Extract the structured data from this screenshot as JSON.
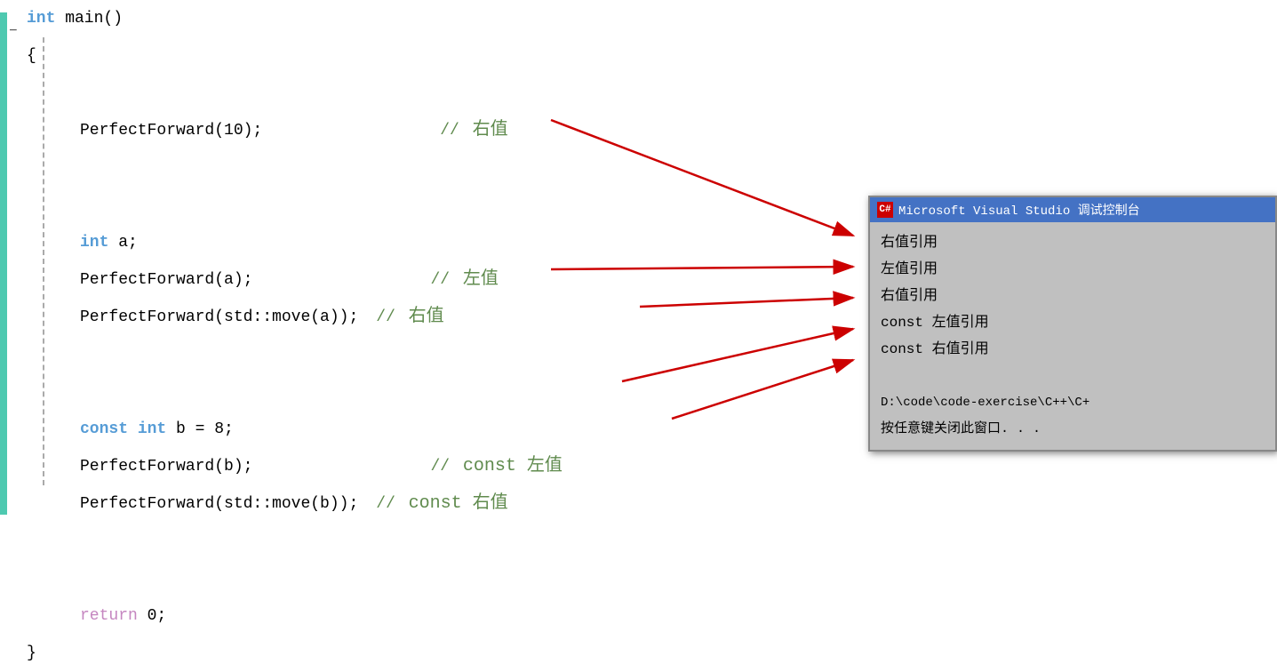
{
  "code": {
    "lines": [
      {
        "id": "line-main",
        "indent": 0,
        "tokens": [
          {
            "t": "int",
            "cls": "kw-blue"
          },
          {
            "t": " main()",
            "cls": "text-normal"
          }
        ],
        "comment": ""
      },
      {
        "id": "line-brace-open",
        "indent": 0,
        "tokens": [
          {
            "t": "{",
            "cls": "text-normal"
          }
        ],
        "comment": ""
      },
      {
        "id": "line-empty1",
        "indent": 1,
        "tokens": [],
        "comment": ""
      },
      {
        "id": "line-pf10",
        "indent": 1,
        "tokens": [
          {
            "t": "PerfectForward(10);",
            "cls": "text-normal"
          }
        ],
        "comment": "// 右值"
      },
      {
        "id": "line-empty2",
        "indent": 1,
        "tokens": [],
        "comment": ""
      },
      {
        "id": "line-empty3",
        "indent": 1,
        "tokens": [],
        "comment": ""
      },
      {
        "id": "line-int-a",
        "indent": 1,
        "tokens": [
          {
            "t": "int",
            "cls": "kw-blue"
          },
          {
            "t": " a;",
            "cls": "text-normal"
          }
        ],
        "comment": ""
      },
      {
        "id": "line-pfa",
        "indent": 1,
        "tokens": [
          {
            "t": "PerfectForward(a);",
            "cls": "text-normal"
          }
        ],
        "comment": "// 左值"
      },
      {
        "id": "line-pfmovea",
        "indent": 1,
        "tokens": [
          {
            "t": "PerfectForward(std::move(a));",
            "cls": "text-normal"
          }
        ],
        "comment": "// 右值"
      },
      {
        "id": "line-empty4",
        "indent": 1,
        "tokens": [],
        "comment": ""
      },
      {
        "id": "line-empty5",
        "indent": 1,
        "tokens": [],
        "comment": ""
      },
      {
        "id": "line-const-b",
        "indent": 1,
        "tokens": [
          {
            "t": "const",
            "cls": "kw-blue"
          },
          {
            "t": " ",
            "cls": "text-normal"
          },
          {
            "t": "int",
            "cls": "kw-blue"
          },
          {
            "t": " b = 8;",
            "cls": "text-normal"
          }
        ],
        "comment": ""
      },
      {
        "id": "line-pfb",
        "indent": 1,
        "tokens": [
          {
            "t": "PerfectForward(b);",
            "cls": "text-normal"
          }
        ],
        "comment": "// const 左值"
      },
      {
        "id": "line-pfmoveb",
        "indent": 1,
        "tokens": [
          {
            "t": "PerfectForward(std::move(b));",
            "cls": "text-normal"
          }
        ],
        "comment": "// const 右值"
      },
      {
        "id": "line-empty6",
        "indent": 1,
        "tokens": [],
        "comment": ""
      },
      {
        "id": "line-empty7",
        "indent": 1,
        "tokens": [],
        "comment": ""
      },
      {
        "id": "line-return",
        "indent": 1,
        "tokens": [
          {
            "t": "return",
            "cls": "kw-purple"
          },
          {
            "t": " 0;",
            "cls": "text-normal"
          }
        ],
        "comment": ""
      },
      {
        "id": "line-brace-close",
        "indent": 0,
        "tokens": [
          {
            "t": "}",
            "cls": "text-normal"
          }
        ],
        "comment": ""
      }
    ]
  },
  "console": {
    "title": "Microsoft Visual Studio 调试控制台",
    "icon_label": "C#",
    "outputs": [
      "右值引用",
      "左值引用",
      "右值引用",
      "const 左值引用",
      "const 右值引用",
      "",
      "D:\\code\\code-exercise\\C++\\C+",
      "按任意键关闭此窗口. . ."
    ]
  },
  "arrows": [
    {
      "id": "arrow-pf10-right",
      "label": "right-val-1"
    },
    {
      "id": "arrow-pfa-left",
      "label": "left-val"
    },
    {
      "id": "arrow-pfmovea-right",
      "label": "right-val-2"
    },
    {
      "id": "arrow-pfb-const-left",
      "label": "const-left-val"
    },
    {
      "id": "arrow-pfmoveb-const-right",
      "label": "const-right-val"
    }
  ]
}
